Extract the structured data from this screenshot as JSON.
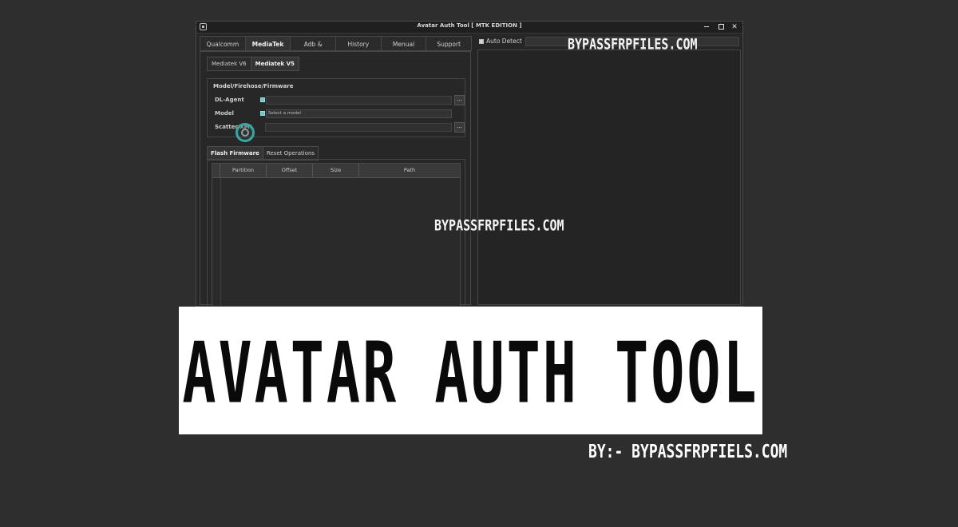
{
  "window": {
    "title": "Avatar Auth Tool [ MTK EDITION ]",
    "controls": {
      "minimize": "−",
      "maximize": "□",
      "close": "✕"
    }
  },
  "main_tabs": [
    "Qualcomm",
    "MediaTek",
    "Adb & Fastboot",
    "History",
    "Menual",
    "Support"
  ],
  "active_main_tab": "MediaTek",
  "sub_tabs": [
    "Mediatek V6",
    "Mediatek V5"
  ],
  "active_sub_tab": "Mediatek V5",
  "model_group": {
    "title": "Model/Firehose/Firmware",
    "dl_agent_label": "DL-Agent",
    "model_label": "Model",
    "model_placeholder": "Select a model",
    "scatter_label": "Scatter/XML",
    "browse_label": "..."
  },
  "flash_tabs": [
    "Flash Firmware",
    "Reset Operations"
  ],
  "active_flash_tab": "Flash Firmware",
  "partition_table": {
    "columns": [
      "Partition",
      "Offset",
      "Size",
      "Path"
    ]
  },
  "right_panel": {
    "auto_detect_label": "Auto Detect",
    "auto_detect_checked": true
  },
  "watermarks": {
    "top": "BYPASSFRPFILES.COM",
    "center": "BYPASSFRPFILES.COM"
  },
  "banner": {
    "title": "AVATAR AUTH TOOL"
  },
  "byline": "BY:- BYPASSFRPFIELS.COM",
  "colors": {
    "background": "#2e2e2e",
    "window": "#262626",
    "accent_check": "#6fc6c8",
    "banner_bg": "#ffffff",
    "banner_text": "#0a0a0a"
  }
}
